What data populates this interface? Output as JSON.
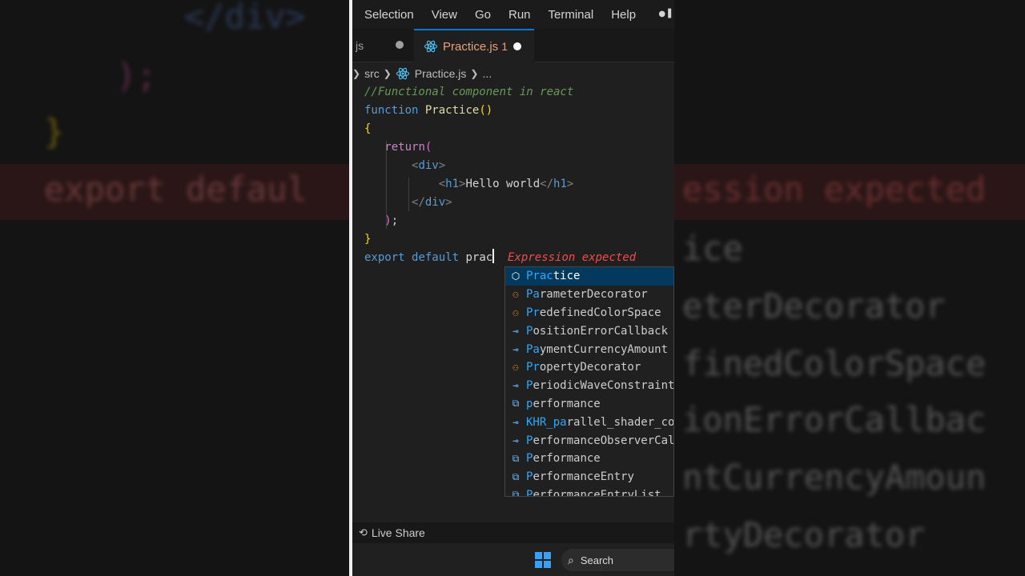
{
  "background": {
    "left_lines": [
      "</div>",
      ");",
      "}",
      "export defaul"
    ],
    "right_lines": [
      "ession expected",
      "ice",
      "eterDecorator",
      "finedColorSpace",
      "ionErrorCallbac",
      "ntCurrencyAmoun",
      "rtyDecorator"
    ]
  },
  "menubar": {
    "items": [
      "Selection",
      "View",
      "Go",
      "Run",
      "Terminal",
      "Help"
    ]
  },
  "tabs": {
    "prev_label": "js",
    "active": {
      "label": "Practice.js",
      "problems": "1",
      "icon": "react-icon"
    }
  },
  "breadcrumb": {
    "folder": "src",
    "file": "Practice.js",
    "more": "..."
  },
  "code": {
    "comment": "//Functional component in react",
    "kw_function": "function",
    "fn_name": "Practice",
    "parens": "()",
    "open_brace": "{",
    "kw_return": "return",
    "return_paren": "(",
    "div_open_lt": "<",
    "div_tag": "div",
    "div_open_gt": ">",
    "h1_open_lt": "<",
    "h1_tag": "h1",
    "h1_open_gt": ">",
    "h1_text": "Hello world",
    "h1_close_lt": "</",
    "h1_close_tag": "h1",
    "h1_close_gt": ">",
    "div_close_lt": "</",
    "div_close_tag": "div",
    "div_close_gt": ">",
    "close_paren": ")",
    "semicolon": ";",
    "close_brace": "}",
    "kw_export": "export",
    "kw_default": "default",
    "typed": "prac",
    "error": "Expression expected"
  },
  "suggestions": [
    {
      "kind": "comp",
      "icon": "component-icon",
      "match": "Prac",
      "rest": "tice"
    },
    {
      "kind": "class",
      "icon": "class-icon",
      "match": "Pa",
      "rest": "rameterDecorator"
    },
    {
      "kind": "class",
      "icon": "class-icon",
      "match": "Pr",
      "rest": "edefinedColorSpace"
    },
    {
      "kind": "iface",
      "icon": "interface-icon",
      "match": "P",
      "rest": "ositionErrorCallback"
    },
    {
      "kind": "iface",
      "icon": "interface-icon",
      "match": "Pa",
      "rest": "ymentCurrencyAmount"
    },
    {
      "kind": "class",
      "icon": "class-icon",
      "match": "Pr",
      "rest": "opertyDecorator"
    },
    {
      "kind": "iface",
      "icon": "interface-icon",
      "match": "P",
      "rest": "eriodicWaveConstraints"
    },
    {
      "kind": "var",
      "icon": "variable-icon",
      "match": "p",
      "rest": "erformance"
    },
    {
      "kind": "iface",
      "icon": "interface-icon",
      "match": "KHR_pa",
      "rest": "rallel_shader_compile"
    },
    {
      "kind": "iface",
      "icon": "interface-icon",
      "match": "P",
      "rest": "erformanceObserverCallback"
    },
    {
      "kind": "var",
      "icon": "variable-icon",
      "match": "P",
      "rest": "erformance"
    },
    {
      "kind": "var",
      "icon": "variable-icon",
      "match": "P",
      "rest": "erformanceEntry"
    },
    {
      "kind": "var",
      "icon": "variable-icon",
      "match": "P",
      "rest": "erformanceEntryList"
    }
  ],
  "statusbar": {
    "live_share": "Live Share"
  },
  "taskbar": {
    "search": "Search"
  }
}
